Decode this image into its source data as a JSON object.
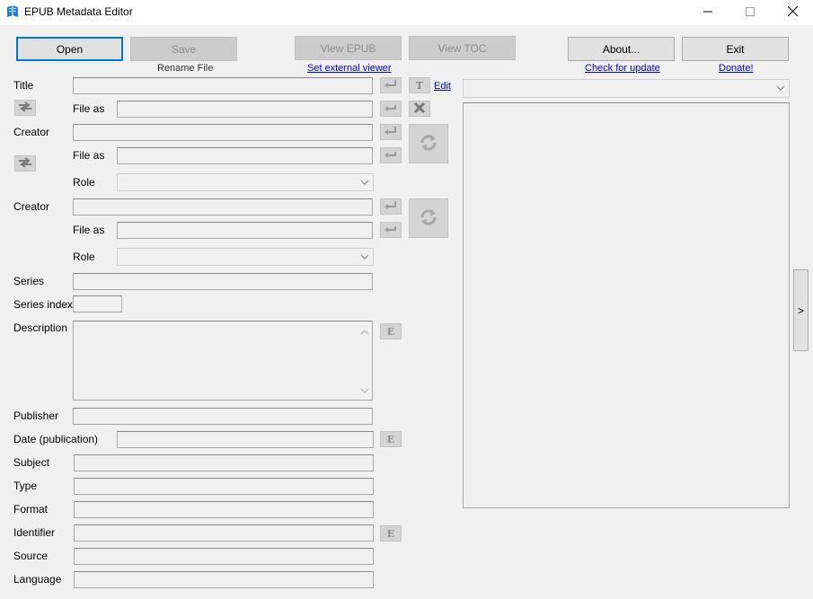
{
  "window": {
    "title": "EPUB Metadata Editor",
    "app_icon": "book-icon",
    "minimize_icon": "minimize-icon",
    "maximize_icon": "maximize-icon",
    "close_icon": "close-icon"
  },
  "toolbar": {
    "open_label": "Open",
    "save_label": "Save",
    "rename_file_label": "Rename File",
    "view_epub_label": "View EPUB",
    "set_external_viewer_label": "Set external viewer",
    "view_toc_label": "View TOC",
    "about_label": "About...",
    "check_update_label": "Check for update",
    "exit_label": "Exit",
    "donate_label": "Donate!"
  },
  "form": {
    "title_label": "Title",
    "file_as_label": "File as",
    "creator_label": "Creator",
    "role_label": "Role",
    "series_label": "Series",
    "series_index_label": "Series index",
    "description_label": "Description",
    "publisher_label": "Publisher",
    "date_label": "Date (publication)",
    "subject_label": "Subject",
    "type_label": "Type",
    "format_label": "Format",
    "identifier_label": "Identifier",
    "source_label": "Source",
    "language_label": "Language",
    "edit_link_label": "Edit",
    "e_button_label": "E",
    "t_button_label": "T"
  },
  "right_panel": {
    "expand_label": ">"
  }
}
